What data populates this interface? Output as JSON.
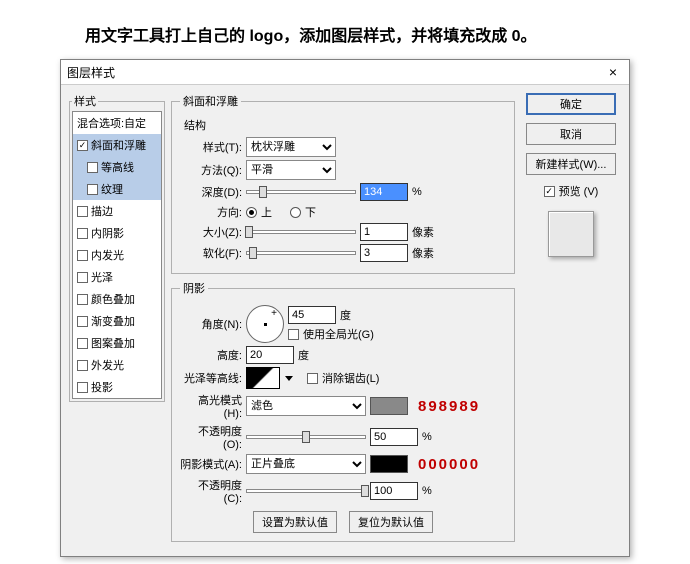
{
  "instruction": "用文字工具打上自己的 logo，添加图层样式，并将填充改成 0。",
  "dialog": {
    "title": "图层样式",
    "close": "×"
  },
  "styles": {
    "legend": "样式",
    "blend": "混合选项:自定",
    "items": [
      {
        "label": "斜面和浮雕",
        "checked": true,
        "sel": true
      },
      {
        "label": "等高线",
        "checked": false,
        "sub": true,
        "sel": true
      },
      {
        "label": "纹理",
        "checked": false,
        "sub": true,
        "sel": true
      },
      {
        "label": "描边",
        "checked": false
      },
      {
        "label": "内阴影",
        "checked": false
      },
      {
        "label": "内发光",
        "checked": false
      },
      {
        "label": "光泽",
        "checked": false
      },
      {
        "label": "颜色叠加",
        "checked": false
      },
      {
        "label": "渐变叠加",
        "checked": false
      },
      {
        "label": "图案叠加",
        "checked": false
      },
      {
        "label": "外发光",
        "checked": false
      },
      {
        "label": "投影",
        "checked": false
      }
    ]
  },
  "bevel": {
    "legend": "斜面和浮雕",
    "struct": "结构",
    "style_l": "样式(T):",
    "style_v": "枕状浮雕",
    "method_l": "方法(Q):",
    "method_v": "平滑",
    "depth_l": "深度(D):",
    "depth_v": "134",
    "pct": "%",
    "dir_l": "方向:",
    "up": "上",
    "down": "下",
    "size_l": "大小(Z):",
    "size_v": "1",
    "px": "像素",
    "soft_l": "软化(F):",
    "soft_v": "3"
  },
  "shade": {
    "legend": "阴影",
    "angle_l": "角度(N):",
    "angle_v": "45",
    "deg": "度",
    "global": "使用全局光(G)",
    "alt_l": "高度:",
    "alt_v": "20",
    "gloss_l": "光泽等高线:",
    "anti": "消除锯齿(L)",
    "hmode_l": "高光模式(H):",
    "hmode_v": "滤色",
    "hcolor": "#898989",
    "hanno": "898989",
    "hopac_l": "不透明度(O):",
    "hopac_v": "50",
    "smode_l": "阴影模式(A):",
    "smode_v": "正片叠底",
    "scolor": "#000000",
    "sanno": "000000",
    "sopac_l": "不透明度(C):",
    "sopac_v": "100"
  },
  "btns": {
    "setdef": "设置为默认值",
    "reset": "复位为默认值",
    "ok": "确定",
    "cancel": "取消",
    "newstyle": "新建样式(W)...",
    "preview": "预览 (V)"
  }
}
